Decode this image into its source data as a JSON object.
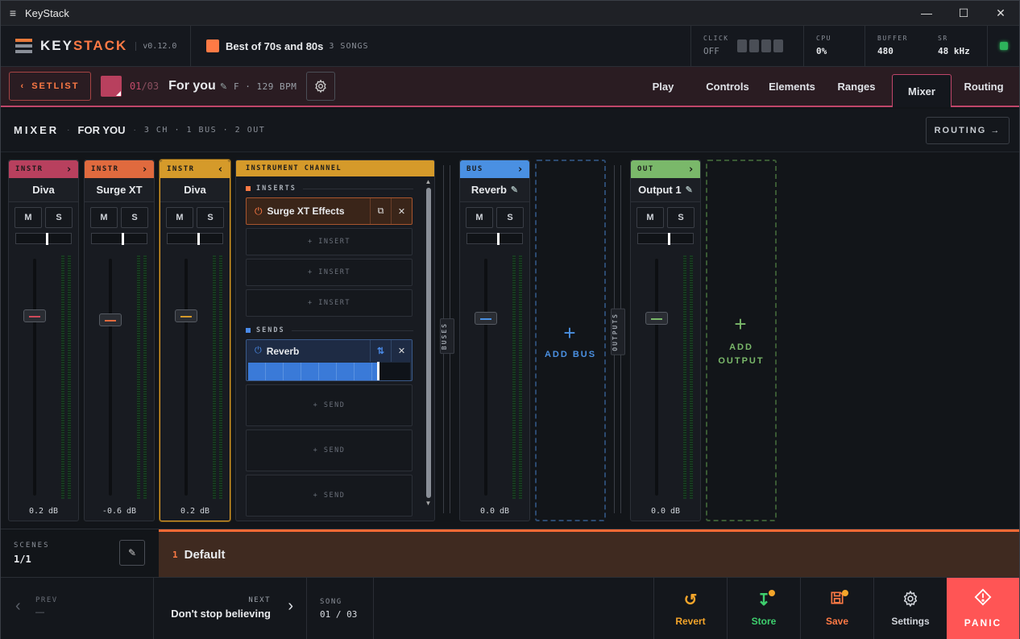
{
  "titlebar": {
    "menu_icon": "≡",
    "title": "KeyStack",
    "minimize": "—",
    "maximize": "☐",
    "close": "✕"
  },
  "header": {
    "logo": {
      "part1": "KEY",
      "part2": "STACK",
      "version": "v0.12.0"
    },
    "song_selector": {
      "title": "Best of 70s and 80s",
      "count": "3 SONGS",
      "color": "#ff7a45"
    },
    "click": {
      "label": "CLICK",
      "value": "OFF"
    },
    "cpu": {
      "label": "CPU",
      "value": "0%"
    },
    "buffer": {
      "label": "BUFFER",
      "value": "480"
    },
    "sr": {
      "label": "SR",
      "value": "48 kHz"
    }
  },
  "songbar": {
    "setlist_label": "SETLIST",
    "index": "01",
    "total": "/03",
    "song_name": "For you",
    "meta": "F · 129 BPM",
    "song_color": "#b8405e",
    "tabs": [
      {
        "label": "Play"
      },
      {
        "label": "Controls"
      },
      {
        "label": "Elements"
      },
      {
        "label": "Ranges"
      },
      {
        "label": "Mixer"
      },
      {
        "label": "Routing"
      }
    ],
    "active_tab": "Mixer"
  },
  "mixer_header": {
    "title": "MIXER",
    "song": "FOR YOU",
    "summary": "3 CH · 1 BUS · 2 OUT",
    "routing_button": "ROUTING →"
  },
  "strips": [
    {
      "type": "INSTR",
      "name": "Diva",
      "db": "0.2 dB",
      "color": "#b8405e",
      "knob_color": "#d04a5a",
      "pan": 0.5,
      "fader": 0.76,
      "arrow": "›"
    },
    {
      "type": "INSTR",
      "name": "Surge XT",
      "db": "-0.6 dB",
      "color": "#e06a3e",
      "knob_color": "#e06a3e",
      "pan": 0.5,
      "fader": 0.74,
      "arrow": "›"
    },
    {
      "type": "INSTR",
      "name": "Diva",
      "db": "0.2 dB",
      "color": "#d59a2a",
      "knob_color": "#d59a2a",
      "pan": 0.5,
      "fader": 0.76,
      "arrow": "‹",
      "selected": true
    }
  ],
  "bus_strip": {
    "type": "BUS",
    "name": "Reverb",
    "db": "0.0 dB",
    "color": "#4a90e2",
    "knob_color": "#4a90e2",
    "pan": 0.5,
    "fader": 0.75,
    "arrow": "›"
  },
  "out_strip": {
    "type": "OUT",
    "name": "Output 1",
    "db": "0.0 dB",
    "color": "#7ab86a",
    "knob_color": "#7ab86a",
    "pan": 0.5,
    "fader": 0.75,
    "arrow": "›"
  },
  "instrument_channel": {
    "header": "INSTRUMENT CHANNEL",
    "inserts_label": "INSERTS",
    "inserts": [
      {
        "name": "Surge XT Effects"
      }
    ],
    "empty_insert_label": "+ INSERT",
    "sends_label": "SENDS",
    "sends": [
      {
        "name": "Reverb",
        "level": 0.8
      }
    ],
    "empty_send_label": "+ SEND"
  },
  "dividers": {
    "buses": "BUSES",
    "outputs": "OUTPUTS"
  },
  "add_bus": {
    "label": "ADD BUS",
    "color": "#4a90e2"
  },
  "add_output": {
    "label": "ADD OUTPUT",
    "color": "#7ab86a"
  },
  "scenes": {
    "label": "SCENES",
    "count": "1/1",
    "items": [
      {
        "num": "1",
        "name": "Default"
      }
    ]
  },
  "footer": {
    "prev": {
      "label": "PREV",
      "value": "—"
    },
    "next": {
      "label": "NEXT",
      "value": "Don't stop believing"
    },
    "song": {
      "label": "SONG",
      "value": "01 / 03"
    },
    "revert": {
      "label": "Revert",
      "color": "#f4a52a"
    },
    "store": {
      "label": "Store",
      "color": "#3ecf6e"
    },
    "save": {
      "label": "Save",
      "color": "#ff7a45"
    },
    "settings": {
      "label": "Settings"
    },
    "panic": {
      "label": "PANIC"
    }
  }
}
